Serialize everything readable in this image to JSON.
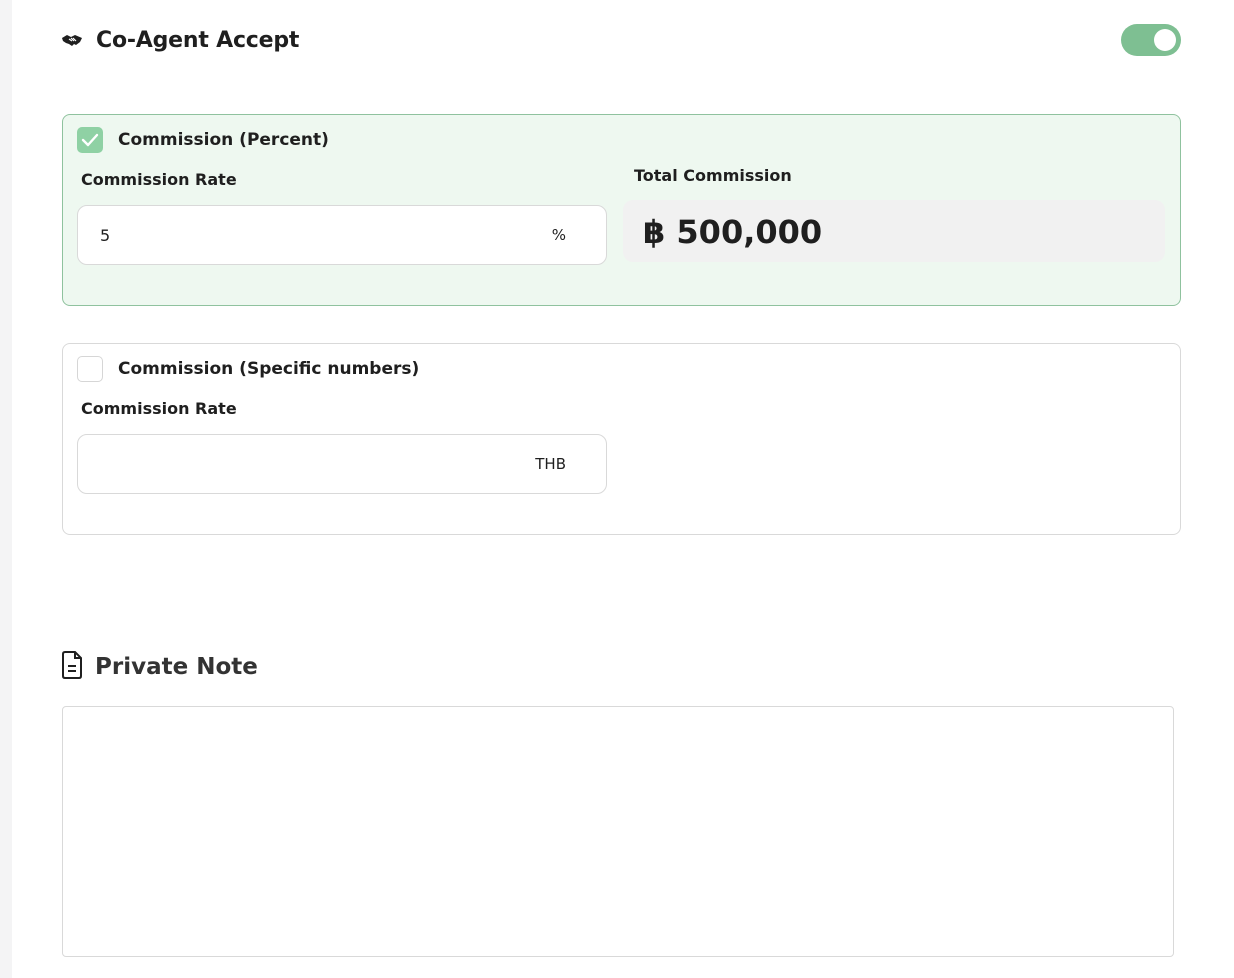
{
  "header": {
    "title": "Co-Agent Accept",
    "icon": "handshake-icon",
    "toggle_on": true,
    "toggle_color": "#7ebf92"
  },
  "commission_percent": {
    "checked": true,
    "title": "Commission (Percent)",
    "rate_label": "Commission Rate",
    "rate_value": "5",
    "rate_suffix": "%",
    "total_label": "Total Commission",
    "total_value": "฿ 500,000",
    "accent_bg": "#eef8f0"
  },
  "commission_specific": {
    "checked": false,
    "title": "Commission (Specific numbers)",
    "rate_label": "Commission Rate",
    "rate_value": "",
    "rate_suffix": "THB"
  },
  "private_note": {
    "title": "Private Note",
    "icon": "document-icon",
    "value": ""
  }
}
